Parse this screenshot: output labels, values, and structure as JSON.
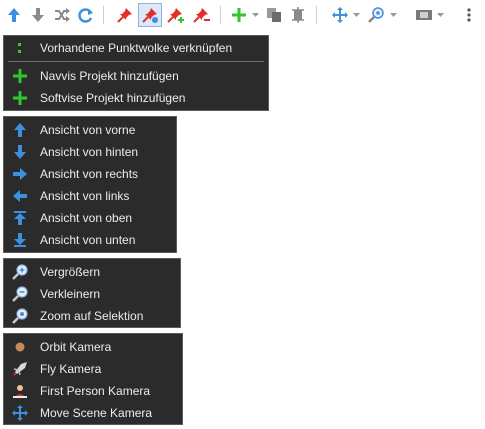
{
  "toolbar": {
    "buttons": [
      {
        "icon": "arrow-up-icon"
      },
      {
        "icon": "arrow-down-icon"
      },
      {
        "icon": "shuffle-icon"
      },
      {
        "icon": "refresh-icon"
      },
      {
        "icon": "pin-icon"
      },
      {
        "icon": "pin-active-icon",
        "active": true
      },
      {
        "icon": "pin-add-icon"
      },
      {
        "icon": "pin-remove-icon"
      },
      {
        "icon": "add-icon"
      },
      {
        "icon": "copy-icon"
      },
      {
        "icon": "point-cloud-icon"
      },
      {
        "icon": "move-scene-icon"
      },
      {
        "icon": "zoom-icon"
      },
      {
        "icon": "camera-icon"
      },
      {
        "icon": "more-icon"
      }
    ]
  },
  "menus": {
    "project": {
      "items": [
        {
          "label": "Vorhandene Punktwolke verknüpfen",
          "icon": "link-point-cloud-icon"
        },
        {
          "label": "Navvis Projekt hinzufügen",
          "icon": "plus-icon"
        },
        {
          "label": "Softvise Projekt hinzufügen",
          "icon": "plus-icon"
        }
      ]
    },
    "views": {
      "items": [
        {
          "label": "Ansicht von vorne",
          "icon": "arrow-up-icon"
        },
        {
          "label": "Ansicht von hinten",
          "icon": "arrow-down-icon"
        },
        {
          "label": "Ansicht von rechts",
          "icon": "arrow-right-icon"
        },
        {
          "label": "Ansicht von links",
          "icon": "arrow-left-icon"
        },
        {
          "label": "Ansicht von oben",
          "icon": "arrow-up-top-icon"
        },
        {
          "label": "Ansicht von unten",
          "icon": "arrow-down-bottom-icon"
        }
      ]
    },
    "zoom": {
      "items": [
        {
          "label": "Vergrößern",
          "icon": "zoom-in-icon"
        },
        {
          "label": "Verkleinern",
          "icon": "zoom-out-icon"
        },
        {
          "label": "Zoom auf Selektion",
          "icon": "zoom-selection-icon"
        }
      ]
    },
    "camera": {
      "items": [
        {
          "label": "Orbit Kamera",
          "icon": "orbit-icon"
        },
        {
          "label": "Fly Kamera",
          "icon": "fly-icon"
        },
        {
          "label": "First Person Kamera",
          "icon": "person-icon"
        },
        {
          "label": "Move Scene Kamera",
          "icon": "move-icon"
        }
      ]
    }
  },
  "colors": {
    "menu_bg": "#2b2b2b",
    "menu_text": "#ececec",
    "accent_blue": "#3d8fe0",
    "accent_green": "#2fc62f",
    "accent_red": "#e0302a"
  }
}
